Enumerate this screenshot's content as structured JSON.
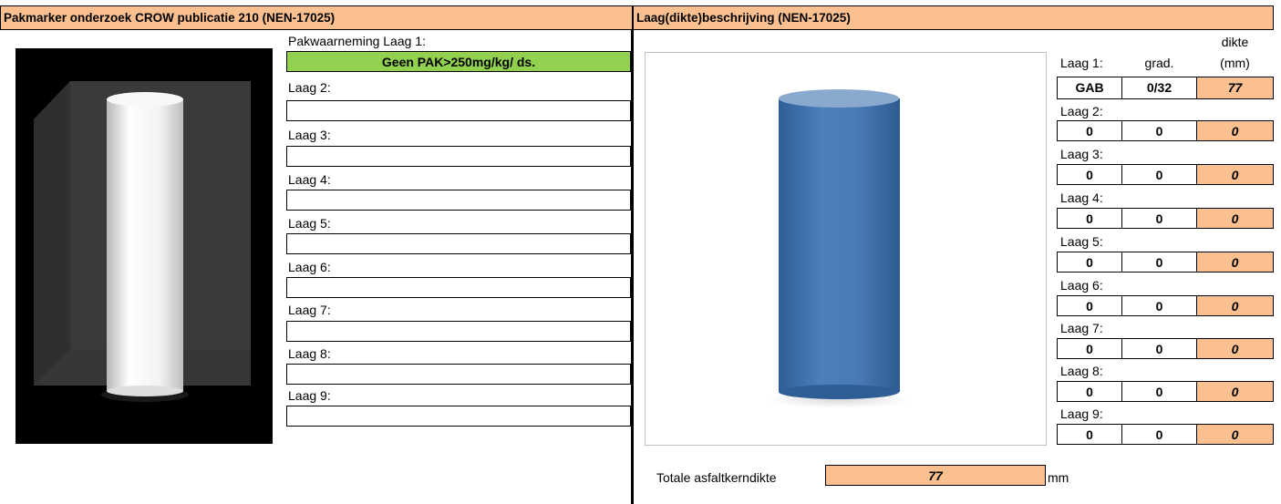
{
  "left_panel": {
    "title": "Pakmarker onderzoek CROW publicatie 210 (NEN-17025)",
    "observation_label": "Pakwaarneming Laag 1:",
    "layer1_result": "Geen PAK>250mg/kg/ ds.",
    "layers": [
      {
        "label": "Laag 2:",
        "value": ""
      },
      {
        "label": "Laag 3:",
        "value": ""
      },
      {
        "label": "Laag 4:",
        "value": ""
      },
      {
        "label": "Laag 5:",
        "value": ""
      },
      {
        "label": "Laag 6:",
        "value": ""
      },
      {
        "label": "Laag 7:",
        "value": ""
      },
      {
        "label": "Laag 8:",
        "value": ""
      },
      {
        "label": "Laag 9:",
        "value": ""
      }
    ]
  },
  "right_panel": {
    "title": "Laag(dikte)beschrijving (NEN-17025)",
    "col_grad": "grad.",
    "col_dikte_line1": "dikte",
    "col_dikte_line2": "(mm)",
    "layers": [
      {
        "label": "Laag 1:",
        "type": "GAB",
        "grad": "0/32",
        "dikte": "77"
      },
      {
        "label": "Laag 2:",
        "type": "0",
        "grad": "0",
        "dikte": "0"
      },
      {
        "label": "Laag 3:",
        "type": "0",
        "grad": "0",
        "dikte": "0"
      },
      {
        "label": "Laag 4:",
        "type": "0",
        "grad": "0",
        "dikte": "0"
      },
      {
        "label": "Laag 5:",
        "type": "0",
        "grad": "0",
        "dikte": "0"
      },
      {
        "label": "Laag 6:",
        "type": "0",
        "grad": "0",
        "dikte": "0"
      },
      {
        "label": "Laag 7:",
        "type": "0",
        "grad": "0",
        "dikte": "0"
      },
      {
        "label": "Laag 8:",
        "type": "0",
        "grad": "0",
        "dikte": "0"
      },
      {
        "label": "Laag 9:",
        "type": "0",
        "grad": "0",
        "dikte": "0"
      }
    ],
    "total_label": "Totale asfaltkerndikte",
    "total_value": "77",
    "total_unit": "mm"
  },
  "colors": {
    "header_bg": "#fac090",
    "result_green": "#92d050",
    "dikte_orange": "#fac090",
    "core_blue": "#4a78b0"
  }
}
